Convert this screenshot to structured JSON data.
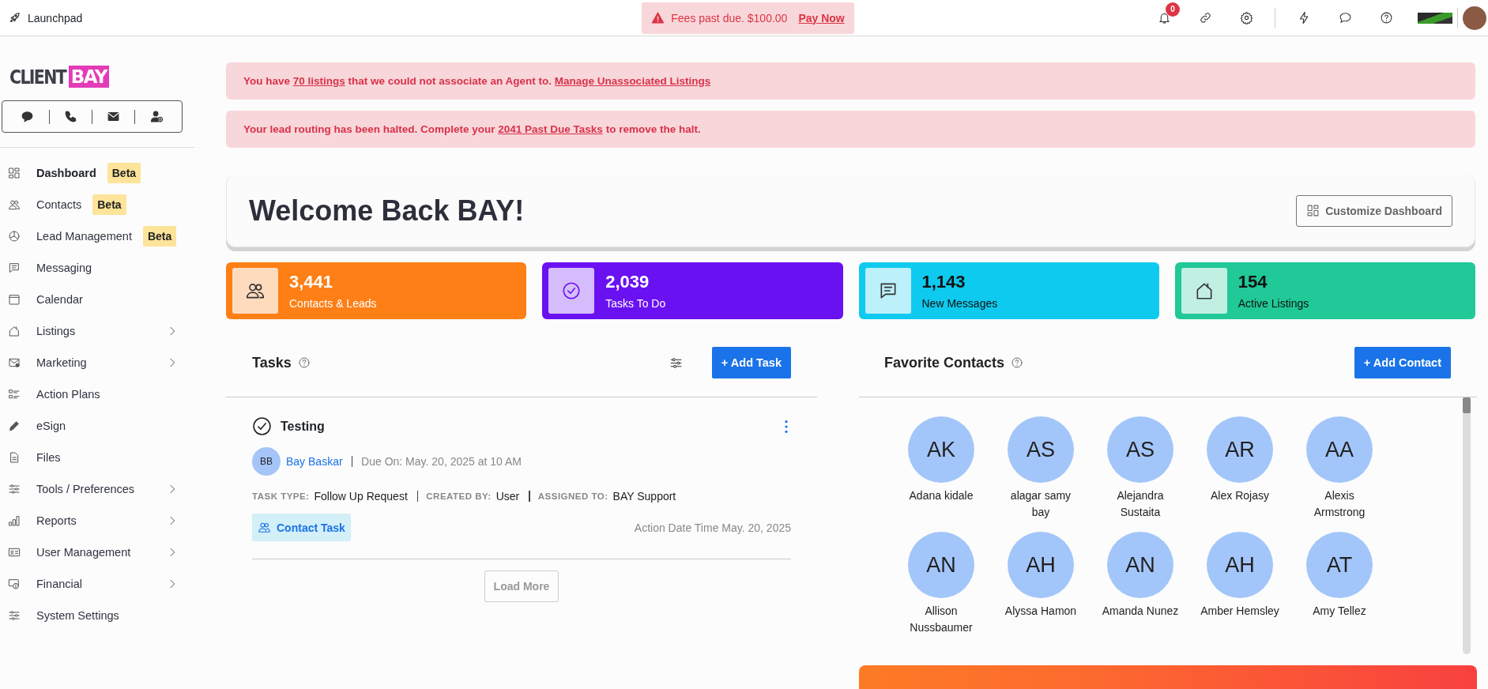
{
  "topbar": {
    "title": "Launchpad",
    "notice": {
      "text": "Fees past due. $100.00",
      "link": "Pay Now"
    },
    "notifications": {
      "count": "0"
    }
  },
  "sidebar": {
    "logo": {
      "first": "CLIENT",
      "second": "BAY"
    },
    "quick_actions": [
      {
        "kind": "chat"
      },
      {
        "kind": "phone"
      },
      {
        "kind": "mail"
      },
      {
        "kind": "add-user"
      }
    ],
    "items": [
      {
        "label": "Dashboard",
        "selected": true,
        "badge": "Beta",
        "submenu": false
      },
      {
        "label": "Contacts",
        "selected": false,
        "badge": "Beta",
        "submenu": false
      },
      {
        "label": "Lead Management",
        "selected": false,
        "badge": "Beta",
        "submenu": false
      },
      {
        "label": "Messaging",
        "selected": false,
        "submenu": false
      },
      {
        "label": "Calendar",
        "selected": false,
        "submenu": false
      },
      {
        "label": "Listings",
        "selected": false,
        "submenu": true
      },
      {
        "label": "Marketing",
        "selected": false,
        "submenu": true
      },
      {
        "label": "Action Plans",
        "selected": false,
        "submenu": false
      },
      {
        "label": "eSign",
        "selected": false,
        "submenu": false
      },
      {
        "label": "Files",
        "selected": false,
        "submenu": false
      },
      {
        "label": "Tools / Preferences",
        "selected": false,
        "submenu": true
      },
      {
        "label": "Reports",
        "selected": false,
        "submenu": true
      },
      {
        "label": "User Management",
        "selected": false,
        "submenu": true
      },
      {
        "label": "Financial",
        "selected": false,
        "submenu": true
      },
      {
        "label": "System Settings",
        "selected": false,
        "submenu": false
      }
    ]
  },
  "alerts": [
    {
      "parts": [
        {
          "kind": "text",
          "text": "You have "
        },
        {
          "kind": "link",
          "text": "70 listings"
        },
        {
          "kind": "text",
          "text": " that we could not associate an Agent to. "
        },
        {
          "kind": "link",
          "text": "Manage Unassociated Listings"
        }
      ]
    },
    {
      "parts": [
        {
          "kind": "text",
          "text": "Your lead routing has been halted. Complete your "
        },
        {
          "kind": "link",
          "text": "2041 Past Due Tasks"
        },
        {
          "kind": "text",
          "text": " to remove the halt."
        }
      ]
    }
  ],
  "welcome": {
    "title": "Welcome Back BAY!",
    "button": "Customize Dashboard"
  },
  "stats": [
    {
      "value": "3,441",
      "label": "Contacts & Leads",
      "color": "#fd7f16"
    },
    {
      "value": "2,039",
      "label": "Tasks To Do",
      "color": "#6a11f2"
    },
    {
      "value": "1,143",
      "label": "New Messages",
      "color": "#0fcaef"
    },
    {
      "value": "154",
      "label": "Active Listings",
      "color": "#20c997"
    }
  ],
  "tasks": {
    "title": "Tasks",
    "add_button": "+ Add Task",
    "items": [
      {
        "title": "Testing",
        "completed": true,
        "initials": "BB",
        "contact": "Bay Baskar",
        "due": "Due On: May. 20, 2025 at 10 AM",
        "meta": [
          {
            "label": "TASK TYPE:",
            "value": "Follow Up Request"
          },
          {
            "label": "CREATED BY:",
            "value": "User"
          },
          {
            "label": "ASSIGNED TO:",
            "value": "BAY Support"
          }
        ],
        "tag": "Contact Task",
        "action_date": "Action Date Time May. 20, 2025"
      }
    ],
    "load_more": {
      "label": "Load More",
      "disabled": true
    }
  },
  "favorites": {
    "title": "Favorite Contacts",
    "add_button": "+ Add Contact",
    "contacts": [
      {
        "initials": "AK",
        "name": "Adana kidale"
      },
      {
        "initials": "AS",
        "name": "alagar samy bay"
      },
      {
        "initials": "AS",
        "name": "Alejandra Sustaita"
      },
      {
        "initials": "AR",
        "name": "Alex Rojasy"
      },
      {
        "initials": "AA",
        "name": "Alexis Armstrong"
      },
      {
        "initials": "AN",
        "name": "Allison Nussbaumer"
      },
      {
        "initials": "AH",
        "name": "Alyssa Hamon"
      },
      {
        "initials": "AN",
        "name": "Amanda Nunez"
      },
      {
        "initials": "AH",
        "name": "Amber Hemsley"
      },
      {
        "initials": "AT",
        "name": "Amy Tellez"
      }
    ]
  }
}
